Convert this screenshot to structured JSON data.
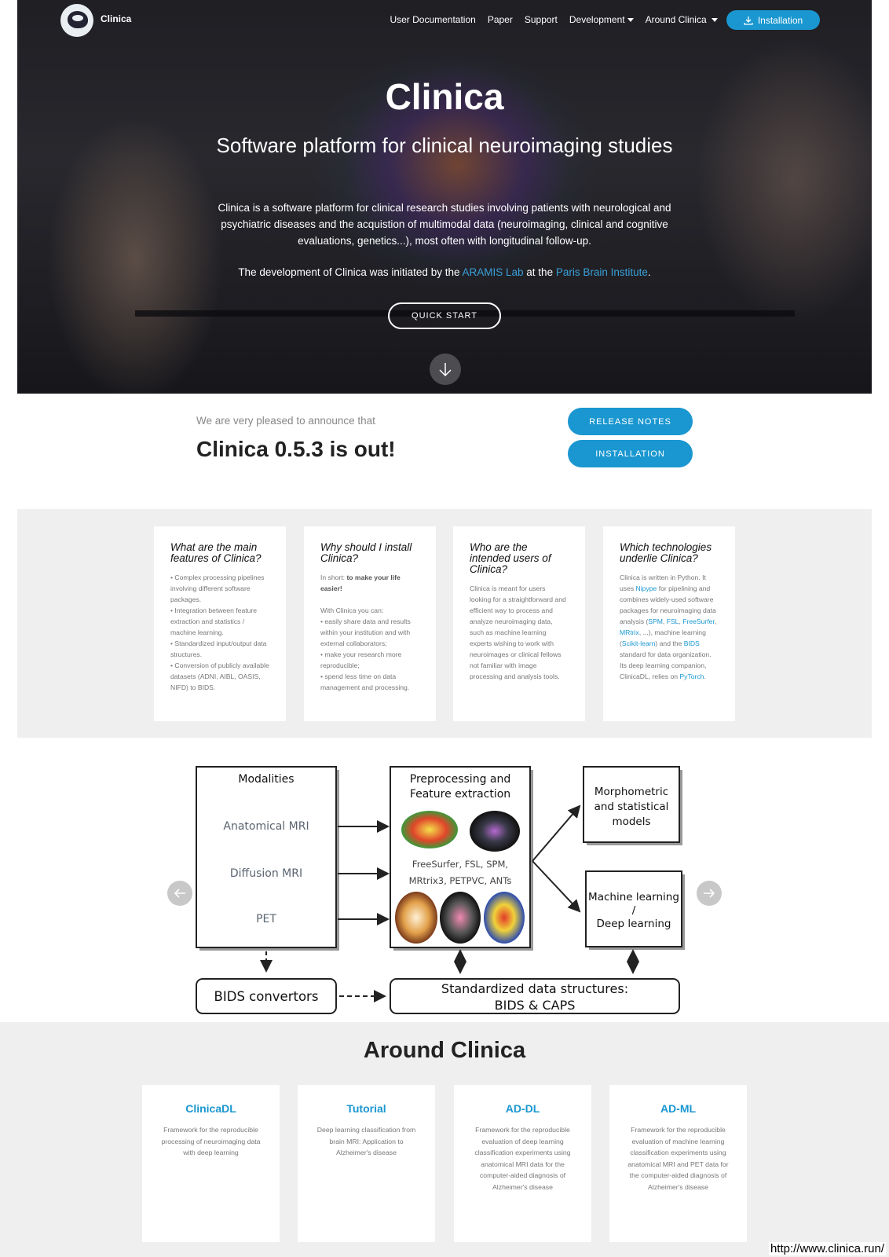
{
  "nav": {
    "brand": "Clinica",
    "items": [
      "User Documentation",
      "Paper",
      "Support"
    ],
    "dropdowns": [
      "Development",
      "Around Clinica"
    ],
    "install_label": "Installation"
  },
  "hero": {
    "title": "Clinica",
    "subtitle": "Software platform for clinical neuroimaging studies",
    "description": "Clinica is a software platform for clinical research studies involving patients with neurological and psychiatric diseases and the acquistion of multimodal data (neuroimaging, clinical and cognitive evaluations, genetics...), most often with longitudinal follow-up.",
    "dev_prefix": "The development of Clinica was initiated by the",
    "dev_link1": "ARAMIS Lab",
    "dev_mid": "at the",
    "dev_link2": "Paris Brain Institute",
    "dev_suffix": ".",
    "quick_start": "QUICK START"
  },
  "announce": {
    "pre": "We are very pleased to announce that",
    "title": "Clinica 0.5.3 is out!",
    "release_notes": "RELEASE NOTES",
    "installation": "INSTALLATION"
  },
  "features": [
    {
      "title": "What are the main features of Clinica?",
      "lines": [
        "• Complex processing pipelines involving different software packages.",
        "• Integration between feature extraction and statistics / machine learning.",
        "• Standardized input/output data structures.",
        "• Conversion of publicly available datasets (ADNI, AIBL, OASIS, NIFD) to BIDS."
      ]
    },
    {
      "title": "Why should I install Clinica?",
      "intro_prefix": "In short: ",
      "intro_bold": "to make your life easier!",
      "lead": "With Clinica you can:",
      "lines": [
        "• easily share data and results within your institution and with external collaborators;",
        "• make your research more reproducible;",
        "• spend less time on data management and processing."
      ]
    },
    {
      "title": "Who are the intended users of Clinica?",
      "text": "Clinica is meant for users looking for a straightforward and efficient way to process and analyze neuroimaging data, such as machine learning experts wishing to work with neuroimages or clinical fellows not familiar with image processing and analysis tools."
    },
    {
      "title": "Which technologies underlie Clinica?",
      "t1": "Clinica is written in Python. It uses ",
      "l1": "Nipype",
      "t2": " for pipelining and combines widely-used software packages for neuroimaging data analysis (",
      "l2": "SPM",
      "t3": ", ",
      "l3": "FSL",
      "t4": ", ",
      "l4": "FreeSurfer",
      "t5": ", ",
      "l5": "MRtrix",
      "t6": ", ...), machine learning (",
      "l6": "Scikit-learn",
      "t7": ") and the ",
      "l7": "BIDS",
      "t8": " standard for data organization.",
      "t9": "Its deep learning companion, ClinicaDL, relies on ",
      "l8": "PyTorch",
      "t10": "."
    }
  ],
  "diagram": {
    "modalities_title": "Modalities",
    "modalities": [
      "Anatomical MRI",
      "Diffusion MRI",
      "PET"
    ],
    "prep_title_1": "Preprocessing and",
    "prep_title_2": "Feature extraction",
    "tools_1": "FreeSurfer, FSL, SPM,",
    "tools_2": "MRtrix3, PETPVC, ANTs",
    "morph_1": "Morphometric",
    "morph_2": "and statistical",
    "morph_3": "models",
    "ml_1": "Machine learning",
    "ml_2": "/",
    "ml_3": "Deep learning",
    "bids_conv": "BIDS convertors",
    "std_1": "Standardized data structures:",
    "std_2": "BIDS & CAPS"
  },
  "around": {
    "title": "Around Clinica",
    "cards": [
      {
        "title": "ClinicaDL",
        "text": "Framework for the reproducible processing of neuroimaging data with deep learning"
      },
      {
        "title": "Tutorial",
        "text": "Deep learning classification from brain MRI: Application to Alzheimer's disease"
      },
      {
        "title": "AD-DL",
        "text": "Framework for the reproducible evaluation of deep learning classification experiments using anatomical MRI data for the computer-aided diagnosis of Alzheimer's disease"
      },
      {
        "title": "AD-ML",
        "text": "Framework for the reproducible evaluation of machine learning classification experiments using anatomical MRI and PET data for the computer-aided diagnosis of Alzheimer's disease"
      }
    ]
  },
  "url": "http://www.clinica.run/",
  "colors": {
    "accent": "#1a97d0",
    "section_bg": "#efefef"
  }
}
